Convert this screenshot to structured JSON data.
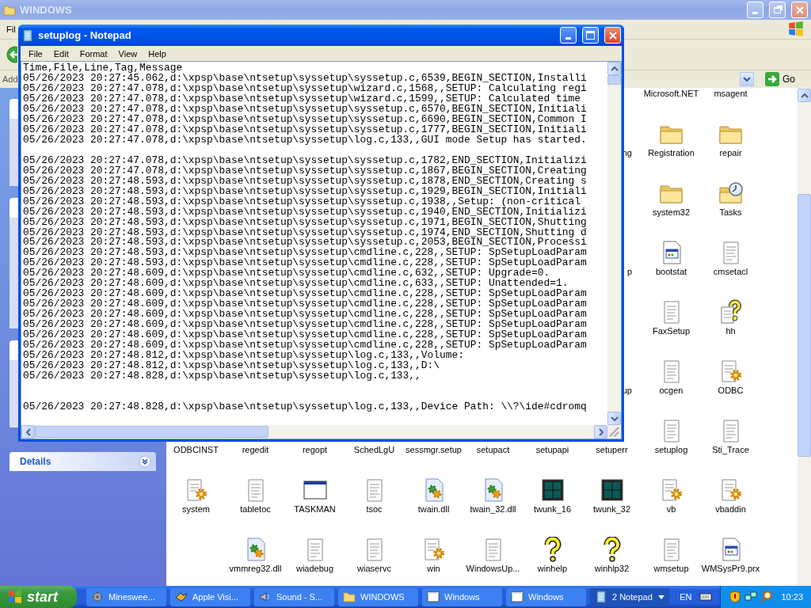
{
  "explorer": {
    "title": "WINDOWS",
    "menu": [
      "Fil"
    ],
    "address_label": "Add",
    "go_button": "Go",
    "details_panel": {
      "title": "Details",
      "expanded": false
    },
    "icon_rows": [
      {
        "items": [
          {
            "label": "Microsoft.NET"
          },
          {
            "label": "msagent"
          }
        ]
      },
      {
        "items": [
          {
            "label": "ng",
            "kind": "cut"
          },
          {
            "label": "Registration",
            "kind": "folder"
          },
          {
            "label": "repair",
            "kind": "folder"
          }
        ]
      },
      {
        "items": [
          {
            "label": "system32",
            "kind": "folder"
          },
          {
            "label": "Tasks",
            "kind": "clock-folder"
          }
        ]
      },
      {
        "items": [
          {
            "label": "p",
            "kind": "cut"
          },
          {
            "label": "bootstat",
            "kind": "window-doc"
          },
          {
            "label": "cmsetacl",
            "kind": "doc"
          }
        ]
      },
      {
        "items": [
          {
            "label": "FaxSetup",
            "kind": "doc"
          },
          {
            "label": "hh",
            "kind": "help-doc"
          }
        ]
      },
      {
        "items": [
          {
            "label": "up",
            "kind": "cut"
          },
          {
            "label": "ocgen",
            "kind": "doc"
          },
          {
            "label": "ODBC",
            "kind": "gear-doc"
          }
        ]
      },
      {
        "items": [
          {
            "label": "ODBCINST"
          },
          {
            "label": "regedit"
          },
          {
            "label": "regopt"
          },
          {
            "label": "SchedLgU"
          },
          {
            "label": "sessmgr.setup"
          },
          {
            "label": "setupact"
          },
          {
            "label": "setupapi"
          },
          {
            "label": "setuperr"
          },
          {
            "label": "setuplog",
            "kind": "doc"
          },
          {
            "label": "Sti_Trace",
            "kind": "doc"
          }
        ]
      },
      {
        "items": [
          {
            "label": "system",
            "kind": "gear-doc"
          },
          {
            "label": "tabletoc",
            "kind": "doc"
          },
          {
            "label": "TASKMAN",
            "kind": "window"
          },
          {
            "label": "tsoc",
            "kind": "doc"
          },
          {
            "label": "twain.dll",
            "kind": "dll"
          },
          {
            "label": "twain_32.dll",
            "kind": "dll"
          },
          {
            "label": "twunk_16",
            "kind": "screen"
          },
          {
            "label": "twunk_32",
            "kind": "screen"
          },
          {
            "label": "vb",
            "kind": "gear-doc"
          },
          {
            "label": "vbaddin",
            "kind": "gear-doc"
          }
        ]
      },
      {
        "items": [
          {
            "label": "vmmreg32.dll",
            "kind": "dll"
          },
          {
            "label": "wiadebug",
            "kind": "doc"
          },
          {
            "label": "wiaservc",
            "kind": "doc"
          },
          {
            "label": "win",
            "kind": "gear-doc"
          },
          {
            "label": "WindowsUp...",
            "kind": "doc"
          },
          {
            "label": "winhelp",
            "kind": "question"
          },
          {
            "label": "winhlp32",
            "kind": "question"
          },
          {
            "label": "wmsetup",
            "kind": "doc"
          },
          {
            "label": "WMSysPr9.prx",
            "kind": "window-doc"
          }
        ]
      }
    ]
  },
  "notepad": {
    "title": "setuplog - Notepad",
    "menu": [
      "File",
      "Edit",
      "Format",
      "View",
      "Help"
    ],
    "text": "Time,File,Line,Tag,Message\n05/26/2023 20:27:45.062,d:\\xpsp\\base\\ntsetup\\syssetup\\syssetup.c,6539,BEGIN_SECTION,Installi\n05/26/2023 20:27:47.078,d:\\xpsp\\base\\ntsetup\\syssetup\\wizard.c,1568,,SETUP: Calculating regi\n05/26/2023 20:27:47.078,d:\\xpsp\\base\\ntsetup\\syssetup\\wizard.c,1599,,SETUP: Calculated time\n05/26/2023 20:27:47.078,d:\\xpsp\\base\\ntsetup\\syssetup\\syssetup.c,6570,BEGIN_SECTION,Initiali\n05/26/2023 20:27:47.078,d:\\xpsp\\base\\ntsetup\\syssetup\\syssetup.c,6690,BEGIN_SECTION,Common I\n05/26/2023 20:27:47.078,d:\\xpsp\\base\\ntsetup\\syssetup\\syssetup.c,1777,BEGIN_SECTION,Initiali\n05/26/2023 20:27:47.078,d:\\xpsp\\base\\ntsetup\\syssetup\\log.c,133,,GUI mode Setup has started.\n\n05/26/2023 20:27:47.078,d:\\xpsp\\base\\ntsetup\\syssetup\\syssetup.c,1782,END_SECTION,Initializi\n05/26/2023 20:27:47.078,d:\\xpsp\\base\\ntsetup\\syssetup\\syssetup.c,1867,BEGIN_SECTION,Creating\n05/26/2023 20:27:48.593,d:\\xpsp\\base\\ntsetup\\syssetup\\syssetup.c,1878,END_SECTION,Creating s\n05/26/2023 20:27:48.593,d:\\xpsp\\base\\ntsetup\\syssetup\\syssetup.c,1929,BEGIN_SECTION,Initiali\n05/26/2023 20:27:48.593,d:\\xpsp\\base\\ntsetup\\syssetup\\syssetup.c,1938,,Setup: (non-critical\n05/26/2023 20:27:48.593,d:\\xpsp\\base\\ntsetup\\syssetup\\syssetup.c,1940,END_SECTION,Initializi\n05/26/2023 20:27:48.593,d:\\xpsp\\base\\ntsetup\\syssetup\\syssetup.c,1971,BEGIN_SECTION,Shutting\n05/26/2023 20:27:48.593,d:\\xpsp\\base\\ntsetup\\syssetup\\syssetup.c,1974,END_SECTION,Shutting d\n05/26/2023 20:27:48.593,d:\\xpsp\\base\\ntsetup\\syssetup\\syssetup.c,2053,BEGIN_SECTION,Processi\n05/26/2023 20:27:48.593,d:\\xpsp\\base\\ntsetup\\syssetup\\cmdline.c,228,,SETUP: SpSetupLoadParam\n05/26/2023 20:27:48.593,d:\\xpsp\\base\\ntsetup\\syssetup\\cmdline.c,228,,SETUP: SpSetupLoadParam\n05/26/2023 20:27:48.609,d:\\xpsp\\base\\ntsetup\\syssetup\\cmdline.c,632,,SETUP: Upgrade=0.\n05/26/2023 20:27:48.609,d:\\xpsp\\base\\ntsetup\\syssetup\\cmdline.c,633,,SETUP: Unattended=1.\n05/26/2023 20:27:48.609,d:\\xpsp\\base\\ntsetup\\syssetup\\cmdline.c,228,,SETUP: SpSetupLoadParam\n05/26/2023 20:27:48.609,d:\\xpsp\\base\\ntsetup\\syssetup\\cmdline.c,228,,SETUP: SpSetupLoadParam\n05/26/2023 20:27:48.609,d:\\xpsp\\base\\ntsetup\\syssetup\\cmdline.c,228,,SETUP: SpSetupLoadParam\n05/26/2023 20:27:48.609,d:\\xpsp\\base\\ntsetup\\syssetup\\cmdline.c,228,,SETUP: SpSetupLoadParam\n05/26/2023 20:27:48.609,d:\\xpsp\\base\\ntsetup\\syssetup\\cmdline.c,228,,SETUP: SpSetupLoadParam\n05/26/2023 20:27:48.609,d:\\xpsp\\base\\ntsetup\\syssetup\\cmdline.c,228,,SETUP: SpSetupLoadParam\n05/26/2023 20:27:48.812,d:\\xpsp\\base\\ntsetup\\syssetup\\log.c,133,,Volume:\n05/26/2023 20:27:48.812,d:\\xpsp\\base\\ntsetup\\syssetup\\log.c,133,,D:\\\n05/26/2023 20:27:48.828,d:\\xpsp\\base\\ntsetup\\syssetup\\log.c,133,,\n\n\n05/26/2023 20:27:48.828,d:\\xpsp\\base\\ntsetup\\syssetup\\log.c,133,,Device Path: \\\\?\\ide#cdromq"
  },
  "taskbar": {
    "start": "start",
    "tasks": [
      {
        "label": "Mineswee...",
        "kind": "mine",
        "selected": false
      },
      {
        "label": "Apple Visi...",
        "kind": "app",
        "selected": false
      },
      {
        "label": "Sound - S...",
        "kind": "speaker",
        "selected": false
      },
      {
        "label": "WINDOWS",
        "kind": "folder",
        "selected": false
      },
      {
        "label": "Windows",
        "kind": "window",
        "selected": false
      },
      {
        "label": "Windows",
        "kind": "window",
        "selected": false
      },
      {
        "label": "2 Notepad",
        "kind": "notepad",
        "selected": true
      }
    ],
    "language": "EN",
    "clock": "10:23"
  }
}
